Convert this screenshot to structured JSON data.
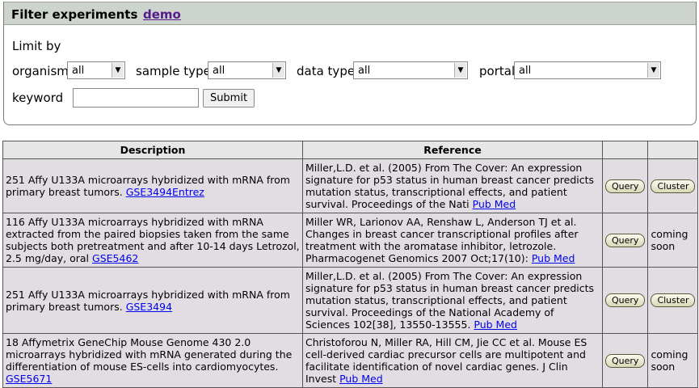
{
  "filter": {
    "title": "Filter experiments",
    "demo_link": "demo",
    "limit_by": "Limit by",
    "organism": {
      "label": "organism",
      "value": "all"
    },
    "sample_type": {
      "label": "sample type",
      "value": "all"
    },
    "data_type": {
      "label": "data type",
      "value": "all"
    },
    "portal": {
      "label": "portal",
      "value": "all"
    },
    "keyword": {
      "label": "keyword",
      "value": ""
    },
    "submit_label": "Submit"
  },
  "table": {
    "headers": {
      "description": "Description",
      "reference": "Reference",
      "query": "",
      "cluster": ""
    },
    "rows": [
      {
        "desc_text": "251 Affy U133A microarrays hybridized with mRNA from primary breast tumors. ",
        "desc_link": "GSE3494Entrez",
        "ref_text": "Miller,L.D. et al. (2005) From The Cover: An expression signature for p53 status in human breast cancer predicts mutation status, transcriptional effects, and patient survival. Proceedings of the Nati ",
        "ref_link": "Pub Med",
        "query": "Query",
        "cluster": "Cluster"
      },
      {
        "desc_text": "116 Affy U133A microarrays hybridized with mRNA extracted from the paired biopsies taken from the same subjects both pretreatment and after 10-14 days Letrozol, 2.5 mg/day, oral ",
        "desc_link": "GSE5462",
        "ref_text": "Miller WR, Larionov AA, Renshaw L, Anderson TJ et al. Changes in breast cancer transcriptional profiles after treatment with the aromatase inhibitor, letrozole. Pharmacogenet Genomics 2007 Oct;17(10): ",
        "ref_link": "Pub Med",
        "query": "Query",
        "cluster": "coming soon"
      },
      {
        "desc_text": "251 Affy U133A microarrays hybridized with mRNA from primary breast tumors. ",
        "desc_link": "GSE3494",
        "ref_text": "Miller,L.D. et al. (2005) From The Cover: An expression signature for p53 status in human breast cancer predicts mutation status, transcriptional effects, and patient survival. Proceedings of the National Academy of Sciences 102[38], 13550-13555. ",
        "ref_link": "Pub Med",
        "query": "Query",
        "cluster": "Cluster"
      },
      {
        "desc_text": "18 Affymetrix GeneChip Mouse Genome 430 2.0 microarrays hybridized with mRNA generated during the differentiation of mouse ES-cells into cardiomyocytes. ",
        "desc_link": "GSE5671",
        "ref_text": "Christoforou N, Miller RA, Hill CM, Jie CC et al. Mouse ES cell-derived cardiac precursor cells are multipotent and facilitate identification of novel cardiac genes. J Clin Invest ",
        "ref_link": "Pub Med",
        "query": "Query",
        "cluster": "coming soon"
      }
    ]
  }
}
